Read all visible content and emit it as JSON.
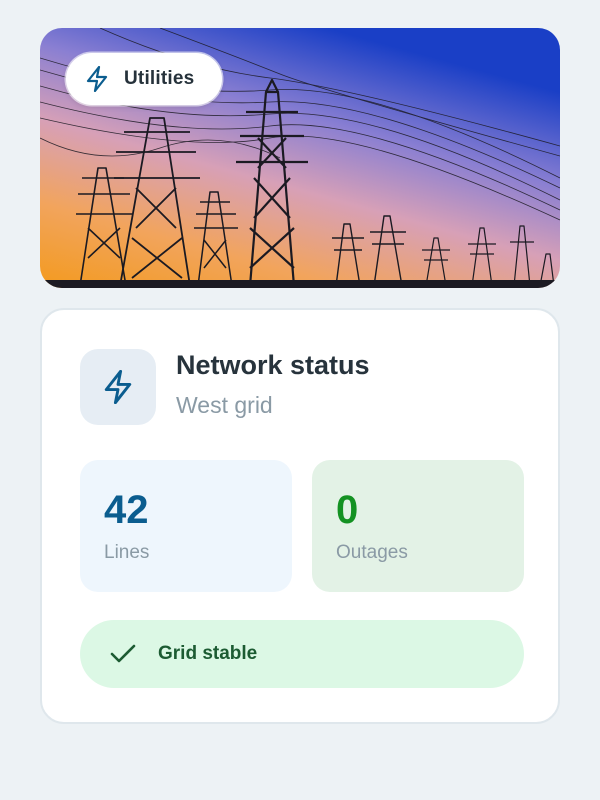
{
  "hero": {
    "image": "electricity-pylons-at-sunset",
    "badge": {
      "icon": "lightning-icon",
      "label": "Utilities"
    }
  },
  "card": {
    "icon": "lightning-icon",
    "title": "Network status",
    "subtitle": "West grid",
    "stats": [
      {
        "value": "42",
        "label": "Lines",
        "color": "#0b5d8f"
      },
      {
        "value": "0",
        "label": "Outages",
        "color": "#149223"
      }
    ],
    "status": {
      "icon": "check-icon",
      "label": "Grid stable",
      "color": "#1c5b32"
    }
  },
  "colors": {
    "accent": "#0b5d8f",
    "background": "#edf2f5",
    "success": "#149223"
  }
}
